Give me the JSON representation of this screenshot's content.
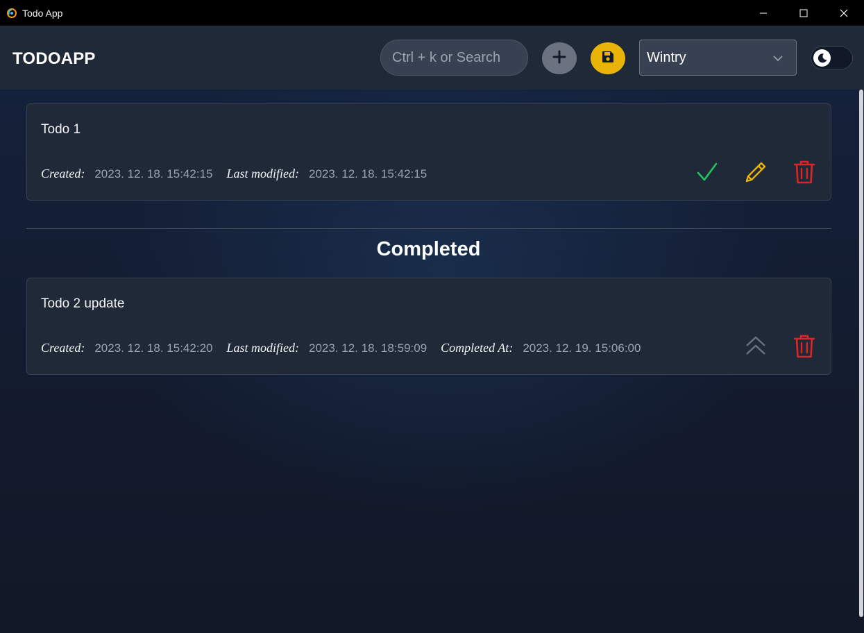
{
  "window": {
    "title": "Todo App",
    "icon": "app-logo-icon",
    "controls": [
      "minimize-icon",
      "maximize-icon",
      "close-icon"
    ]
  },
  "header": {
    "brand": "TODOAPP",
    "search_placeholder": "Ctrl + k or Search",
    "add_icon": "plus-icon",
    "save_icon": "floppy-disk-icon",
    "theme_selected": "Wintry",
    "toggle_icon": "moon-icon"
  },
  "todos": [
    {
      "title": "Todo 1",
      "created_label": "Created:",
      "created": "2023. 12. 18. 15:42:15",
      "modified_label": "Last modified:",
      "modified": "2023. 12. 18. 15:42:15",
      "actions": [
        "check-icon",
        "pencil-icon",
        "trash-icon"
      ]
    }
  ],
  "completed_section": {
    "title": "Completed",
    "items": [
      {
        "title": "Todo 2 update",
        "created_label": "Created:",
        "created": "2023. 12. 18. 15:42:20",
        "modified_label": "Last modified:",
        "modified": "2023. 12. 18. 18:59:09",
        "completed_label": "Completed At:",
        "completed": "2023. 12. 19. 15:06:00",
        "actions": [
          "chevrons-up-icon",
          "trash-icon"
        ]
      }
    ]
  },
  "colors": {
    "check": "#22c55e",
    "pencil": "#eab308",
    "trash": "#dc2626",
    "save_button": "#eab308",
    "add_button": "#6b7280"
  }
}
